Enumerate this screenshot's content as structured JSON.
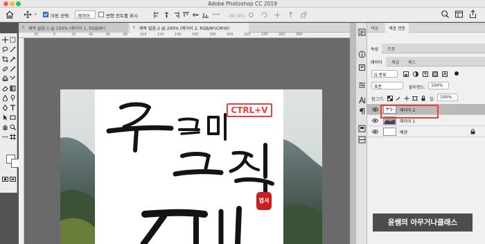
{
  "window": {
    "title": "Adobe Photoshop CC 2019"
  },
  "options_bar": {
    "auto_select_label": "자동 선택:",
    "auto_select_value": "레이어",
    "transform_controls_label": "변형 컨트롤 표시",
    "mode_3d_label": "3D 모드:"
  },
  "tabs": [
    {
      "label": "제목 없음-1 @ 100% (레이어 1, RGB/8*)",
      "close": "×"
    },
    {
      "label": "제목 없음-2 @ 200% (레이어 2, RGB/8*/CMYK)",
      "close": "×"
    }
  ],
  "ruler_labels": [
    "20",
    "0",
    "20",
    "40",
    "60",
    "80",
    "100",
    "120",
    "140",
    "160",
    "180",
    "200",
    "220",
    "240",
    "260",
    "280"
  ],
  "canvas": {
    "ctrl_v_label": "CTRL+V",
    "seal_text": "엽서"
  },
  "panels": {
    "top_tabs": [
      "색상",
      "색상 견본"
    ],
    "mid_tabs": [
      "속성",
      "조정"
    ],
    "layer_tabs": [
      "레이어",
      "채널",
      "패스"
    ],
    "filter_kind": "Q 종류",
    "blend_mode": "표준",
    "opacity_label": "불투명도:",
    "opacity_value": "100%",
    "lock_label": "잠그기:",
    "fill_label": "칠:",
    "fill_value": "100%",
    "layers": [
      {
        "name": "레이어 2",
        "selected": true
      },
      {
        "name": "레이어 1",
        "selected": false
      },
      {
        "name": "배경",
        "selected": false,
        "locked": true
      }
    ]
  },
  "watermark": "윤쌤의 아무거나클래스",
  "colors": {
    "accent_red": "#e8423a",
    "seal_red": "#c9201f",
    "selection_blue": "#3b7ce0"
  }
}
